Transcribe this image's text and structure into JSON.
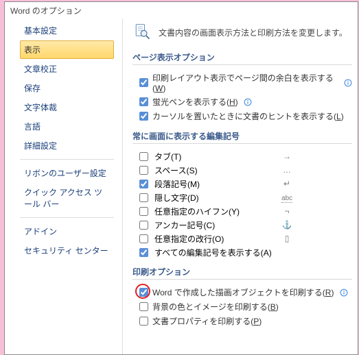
{
  "title": "Word のオプション",
  "sidebar": {
    "items": [
      {
        "label": "基本設定"
      },
      {
        "label": "表示"
      },
      {
        "label": "文章校正"
      },
      {
        "label": "保存"
      },
      {
        "label": "文字体裁"
      },
      {
        "label": "言語"
      },
      {
        "label": "詳細設定"
      }
    ],
    "items2": [
      {
        "label": "リボンのユーザー設定"
      },
      {
        "label": "クイック アクセス ツール バー"
      }
    ],
    "items3": [
      {
        "label": "アドイン"
      },
      {
        "label": "セキュリティ センター"
      }
    ],
    "selectedIndex": 1
  },
  "header": {
    "text": "文書内容の画面表示方法と印刷方法を変更します。"
  },
  "sections": {
    "pageDisplay": {
      "title": "ページ表示オプション",
      "items": [
        {
          "label_a": "印刷レイアウト表示でページ間の余白を表示する(",
          "key": "W",
          "label_b": ")",
          "checked": true,
          "info": true
        },
        {
          "label_a": "蛍光ペンを表示する(",
          "key": "H",
          "label_b": ")",
          "checked": true,
          "info": true
        },
        {
          "label_a": "カーソルを置いたときに文書のヒントを表示する(",
          "key": "L",
          "label_b": ")",
          "checked": true,
          "info": false
        }
      ]
    },
    "marks": {
      "title": "常に画面に表示する編集記号",
      "items": [
        {
          "label_a": "タブ(",
          "key": "T",
          "label_b": ")",
          "sym": "→",
          "checked": false
        },
        {
          "label_a": "スペース(",
          "key": "S",
          "label_b": ")",
          "sym": "…",
          "checked": false
        },
        {
          "label_a": "段落記号(",
          "key": "M",
          "label_b": ")",
          "sym": "↵",
          "checked": true
        },
        {
          "label_a": "隠し文字(",
          "key": "D",
          "label_b": ")",
          "sym": "abc",
          "checked": false,
          "dotted": true
        },
        {
          "label_a": "任意指定のハイフン(",
          "key": "Y",
          "label_b": ")",
          "sym": "¬",
          "checked": false
        },
        {
          "label_a": "アンカー記号(",
          "key": "C",
          "label_b": ")",
          "sym": "⚓",
          "checked": false
        },
        {
          "label_a": "任意指定の改行(",
          "key": "O",
          "label_b": ")",
          "sym": "▯",
          "checked": false
        },
        {
          "label_a": "すべての編集記号を表示する(",
          "key": "A",
          "label_b": ")",
          "sym": "",
          "checked": true
        }
      ]
    },
    "print": {
      "title": "印刷オプション",
      "items": [
        {
          "label_a": "Word で作成した描画オブジェクトを印刷する(",
          "key": "R",
          "label_b": ")",
          "checked": true,
          "info": true,
          "highlight": true
        },
        {
          "label_a": "背景の色とイメージを印刷する(",
          "key": "B",
          "label_b": ")",
          "checked": false,
          "info": false
        },
        {
          "label_a": "文書プロパティを印刷する(",
          "key": "P",
          "label_b": ")",
          "checked": false,
          "info": false
        }
      ]
    }
  }
}
